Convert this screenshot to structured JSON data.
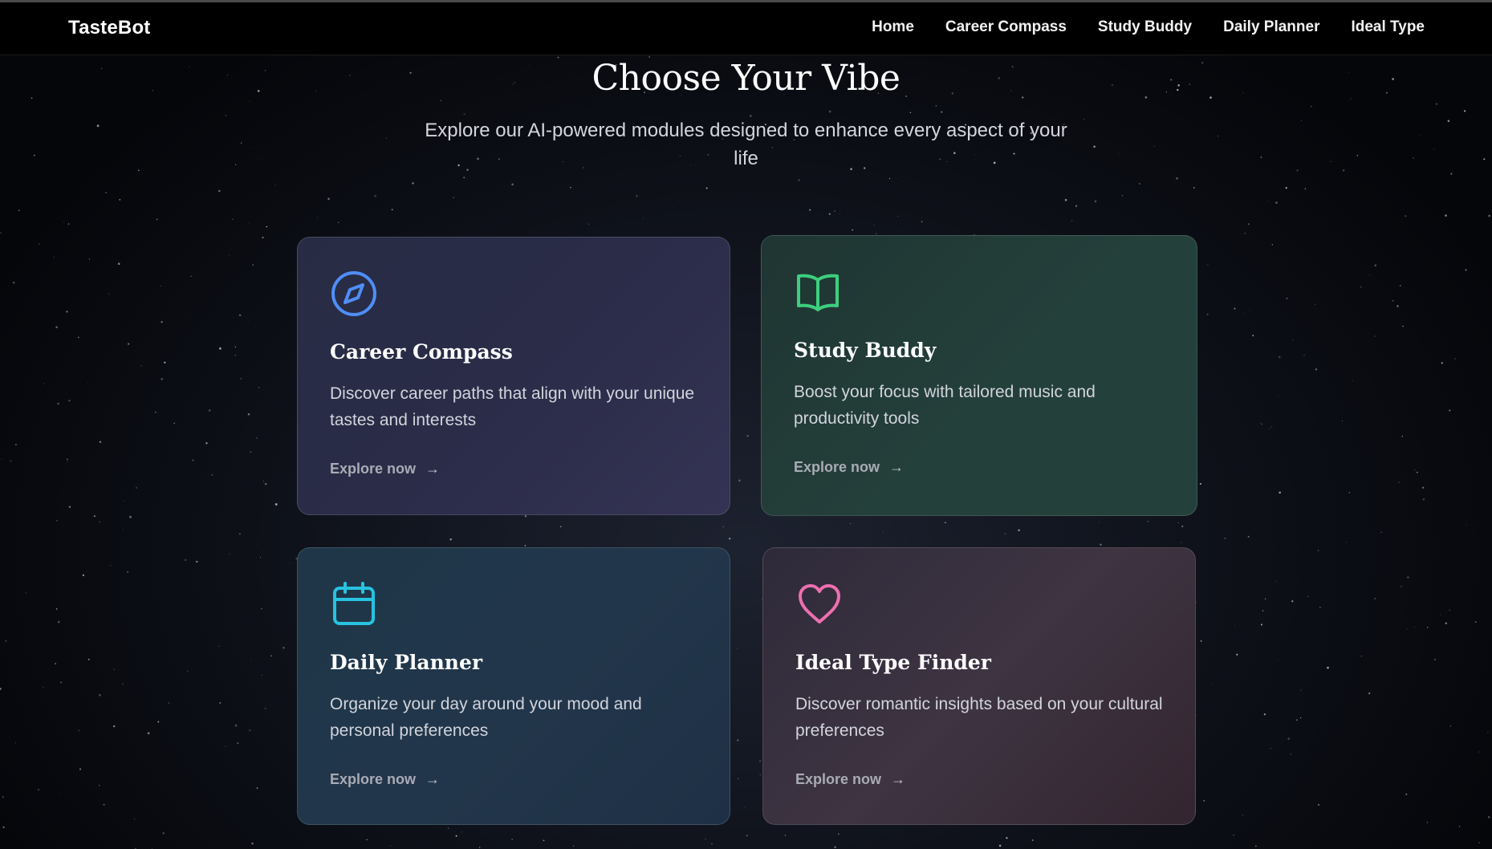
{
  "nav": {
    "brand": "TasteBot",
    "links": [
      "Home",
      "Career Compass",
      "Study Buddy",
      "Daily Planner",
      "Ideal Type"
    ]
  },
  "hero": {
    "title": "Choose Your Vibe",
    "subtitle": "Explore our AI-powered modules designed to enhance every aspect of your life"
  },
  "cards": [
    {
      "icon": "compass-icon",
      "accent": "#4f8ef7",
      "title": "Career Compass",
      "description": "Discover career paths that align with your unique tastes and interests",
      "link": "Explore now",
      "arrow": "→"
    },
    {
      "icon": "book-icon",
      "accent": "#3ccf7e",
      "title": "Study Buddy",
      "description": "Boost your focus with tailored music and productivity tools",
      "link": "Explore now",
      "arrow": "→"
    },
    {
      "icon": "calendar-icon",
      "accent": "#27c3e0",
      "title": "Daily Planner",
      "description": "Organize your day around your mood and personal preferences",
      "link": "Explore now",
      "arrow": "→"
    },
    {
      "icon": "heart-icon",
      "accent": "#ee6fb0",
      "title": "Ideal Type Finder",
      "description": "Discover romantic insights based on your cultural preferences",
      "link": "Explore now",
      "arrow": "→"
    }
  ]
}
